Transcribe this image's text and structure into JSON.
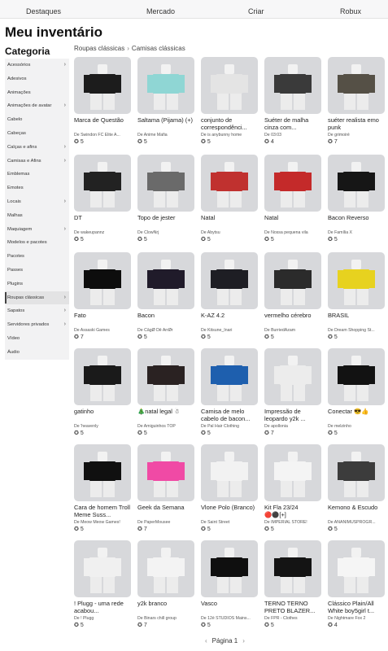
{
  "nav": {
    "items": [
      "Destaques",
      "Mercado",
      "Criar",
      "Robux"
    ]
  },
  "page_title": "Meu inventário",
  "category_title": "Categoria",
  "sidebar": {
    "items": [
      {
        "label": "Acessórios",
        "has_chevron": true,
        "selected": false
      },
      {
        "label": "Adesivos",
        "has_chevron": false,
        "selected": false
      },
      {
        "label": "Animações",
        "has_chevron": false,
        "selected": false
      },
      {
        "label": "Animações de avatar",
        "has_chevron": true,
        "selected": false
      },
      {
        "label": "Cabelo",
        "has_chevron": false,
        "selected": false
      },
      {
        "label": "Cabeças",
        "has_chevron": false,
        "selected": false
      },
      {
        "label": "Calças e afins",
        "has_chevron": true,
        "selected": false
      },
      {
        "label": "Camisas e Afins",
        "has_chevron": true,
        "selected": false
      },
      {
        "label": "Emblemas",
        "has_chevron": false,
        "selected": false
      },
      {
        "label": "Emotes",
        "has_chevron": false,
        "selected": false
      },
      {
        "label": "Locais",
        "has_chevron": true,
        "selected": false
      },
      {
        "label": "Malhas",
        "has_chevron": false,
        "selected": false
      },
      {
        "label": "Maquiagem",
        "has_chevron": true,
        "selected": false
      },
      {
        "label": "Modelos e pacotes",
        "has_chevron": false,
        "selected": false
      },
      {
        "label": "Pacotes",
        "has_chevron": false,
        "selected": false
      },
      {
        "label": "Passes",
        "has_chevron": false,
        "selected": false
      },
      {
        "label": "Plugins",
        "has_chevron": false,
        "selected": false
      },
      {
        "label": "Roupas clássicas",
        "has_chevron": true,
        "selected": true
      },
      {
        "label": "Sapatos",
        "has_chevron": true,
        "selected": false
      },
      {
        "label": "Servidores privados",
        "has_chevron": true,
        "selected": false
      },
      {
        "label": "Vídeo",
        "has_chevron": false,
        "selected": false
      },
      {
        "label": "Áudio",
        "has_chevron": false,
        "selected": false
      }
    ]
  },
  "breadcrumb": {
    "parent": "Roupas clássicas",
    "current": "Camisas clássicas"
  },
  "items": [
    {
      "name": "Marca de Questão",
      "creator": "De Swindon FC Elite A...",
      "favorites": "5",
      "color": "#1c1c1c",
      "icon": "?"
    },
    {
      "name": "Saltama (Pijama) (+)",
      "creator": "De Anime Mafia",
      "favorites": "5",
      "color": "#8fd6d4",
      "icon": ""
    },
    {
      "name": "conjunto de correspondênci...",
      "creator": "De is anybunny home",
      "favorites": "5",
      "color": "#e4e4e4",
      "icon": ""
    },
    {
      "name": "Suéter de malha cinza com...",
      "creator": "De 03:03",
      "favorites": "4",
      "color": "#3a3a3a",
      "icon": ""
    },
    {
      "name": "suéter realista emo punk",
      "creator": "De grimoiré",
      "favorites": "7",
      "color": "#555046",
      "icon": ""
    },
    {
      "name": "DT",
      "creator": "De wakeupannz",
      "favorites": "5",
      "color": "#222222",
      "icon": ""
    },
    {
      "name": "Topo de jester",
      "creator": "De ClowNrj",
      "favorites": "5",
      "color": "#6a6a6a",
      "icon": ""
    },
    {
      "name": "Natal",
      "creator": "De Abytsu",
      "favorites": "5",
      "color": "#c0312f",
      "icon": ""
    },
    {
      "name": "Natal",
      "creator": "De Nossa pequena vila",
      "favorites": "5",
      "color": "#c42a2a",
      "icon": ""
    },
    {
      "name": "Bacon Reverso",
      "creator": "De Família X",
      "favorites": "5",
      "color": "#161616",
      "icon": ""
    },
    {
      "name": "Fato",
      "creator": "De Assaski Games",
      "favorites": "7",
      "color": "#0d0d0d",
      "icon": ""
    },
    {
      "name": "Bacon",
      "creator": "De CāgØ Dē ArrØr",
      "favorites": "5",
      "color": "#201b2a",
      "icon": ""
    },
    {
      "name": "K-AZ 4.2",
      "creator": "De Kitsune_Inari",
      "favorites": "5",
      "color": "#1e1e24",
      "icon": ""
    },
    {
      "name": "vermelho cérebro",
      "creator": "De BurriedAzam",
      "favorites": "5",
      "color": "#2b2b2b",
      "icon": ""
    },
    {
      "name": "BRASIL",
      "creator": "De Dream Shopping St...",
      "favorites": "5",
      "color": "#e7d21f",
      "icon": ""
    },
    {
      "name": "gatinho",
      "creator": "De 'heavenly",
      "favorites": "5",
      "color": "#1a1a1a",
      "icon": ""
    },
    {
      "name": "🎄natal legal ☃",
      "creator": "De Amiguinhos TOP",
      "favorites": "5",
      "color": "#2a2222",
      "icon": ""
    },
    {
      "name": "Camisa de melo cabelo de bacon...",
      "creator": "De Pal Hair Clothing",
      "favorites": "5",
      "color": "#1e5fae",
      "icon": ""
    },
    {
      "name": "Impressão de leopardo y2k ...",
      "creator": "De apollonia",
      "favorites": "7",
      "color": "#ececec",
      "icon": ""
    },
    {
      "name": "Conectar 😎👍",
      "creator": "De melzinho",
      "favorites": "5",
      "color": "#121212",
      "icon": ""
    },
    {
      "name": "Cara de homem Troll Meme Suss...",
      "creator": "De Meow Meow Games!",
      "favorites": "5",
      "color": "#101010",
      "icon": ""
    },
    {
      "name": "Geek da Semana",
      "creator": "De PaperMousee",
      "favorites": "7",
      "color": "#f04aa5",
      "icon": ""
    },
    {
      "name": "Vlone Polo (Branco)",
      "creator": "De Saint Street",
      "favorites": "5",
      "color": "#f2f2f2",
      "icon": ""
    },
    {
      "name": "Kit Fla 23/24 🔴⚫[+]",
      "creator": "De IMPERIAL STORE!",
      "favorites": "5",
      "color": "#f4f4f4",
      "icon": ""
    },
    {
      "name": "Kemono & Escudo",
      "creator": "De ANANIMUSPROGR...",
      "favorites": "5",
      "color": "#3c3c3c",
      "icon": ""
    },
    {
      "name": "! Plugg - uma rede acabou...",
      "creator": "De ! Plugg",
      "favorites": "5",
      "color": "#f0f0f0",
      "icon": ""
    },
    {
      "name": "y2k branco",
      "creator": "De Binars chill group",
      "favorites": "7",
      "color": "#f3f3f3",
      "icon": ""
    },
    {
      "name": "Vasco",
      "creator": "De 12é STUDIOS Mains...",
      "favorites": "5",
      "color": "#0f0f0f",
      "icon": ""
    },
    {
      "name": "TERNO TERNO PRETO BLAZER...",
      "creator": "De FPR - Clothes",
      "favorites": "5",
      "color": "#141414",
      "icon": ""
    },
    {
      "name": "Clássico Plain/All White boy5girl t...",
      "creator": "De Nightmare Fox 2",
      "favorites": "4",
      "color": "#f5f5f5",
      "icon": ""
    }
  ],
  "pagination": {
    "prev": "‹",
    "label": "Página 1",
    "next": "›"
  }
}
